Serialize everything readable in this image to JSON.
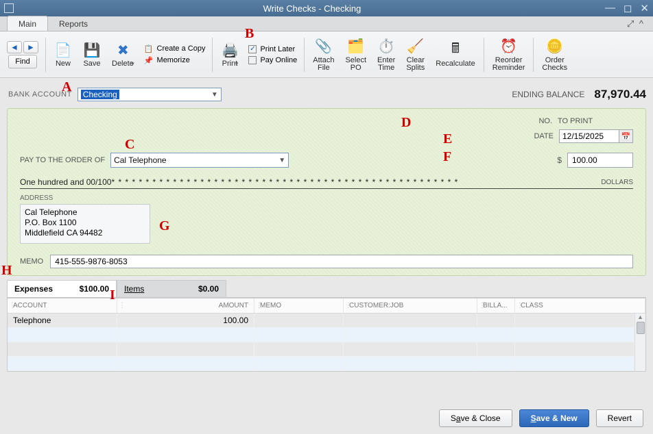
{
  "window": {
    "title": "Write Checks - Checking"
  },
  "tabs": {
    "main": "Main",
    "reports": "Reports"
  },
  "toolbar": {
    "find": "Find",
    "new": "New",
    "save": "Save",
    "delete": "Delete",
    "create_copy": "Create a Copy",
    "memorize": "Memorize",
    "print": "Print",
    "print_later": "Print Later",
    "pay_online": "Pay Online",
    "attach_file": "Attach\nFile",
    "select_po": "Select\nPO",
    "enter_time": "Enter\nTime",
    "clear_splits": "Clear\nSplits",
    "recalculate": "Recalculate",
    "reorder_reminder": "Reorder\nReminder",
    "order_checks": "Order\nChecks"
  },
  "bank": {
    "label": "BANK ACCOUNT",
    "value": "Checking",
    "ending_label": "ENDING BALANCE",
    "ending_value": "87,970.44"
  },
  "check": {
    "no_label": "NO.",
    "no_value": "TO PRINT",
    "date_label": "DATE",
    "date_value": "12/15/2025",
    "pay_to_label": "PAY TO THE ORDER OF",
    "payee": "Cal Telephone",
    "currency": "$",
    "amount": "100.00",
    "amount_words": "One hundred and 00/100",
    "dollars": "DOLLARS",
    "address_label": "ADDRESS",
    "address": "Cal Telephone\nP.O. Box 1100\nMiddlefield CA 94482",
    "memo_label": "MEMO",
    "memo": "415-555-9876-8053"
  },
  "callouts": {
    "A": "A",
    "B": "B",
    "C": "C",
    "D": "D",
    "E": "E",
    "F": "F",
    "G": "G",
    "H": "H",
    "I": "I"
  },
  "subtabs": {
    "expenses_label": "Expenses",
    "expenses_amt": "$100.00",
    "items_label": "Items",
    "items_amt": "$0.00"
  },
  "grid": {
    "headers": {
      "account": "ACCOUNT",
      "amount": "AMOUNT",
      "memo": "MEMO",
      "customer": "CUSTOMER:JOB",
      "billable": "BILLA...",
      "class": "CLASS"
    },
    "rows": [
      {
        "account": "Telephone",
        "amount": "100.00",
        "memo": "",
        "customer": "",
        "billable": "",
        "class": ""
      }
    ]
  },
  "footer": {
    "save_close": "Save & Close",
    "save_new": "Save & New",
    "revert": "Revert"
  }
}
